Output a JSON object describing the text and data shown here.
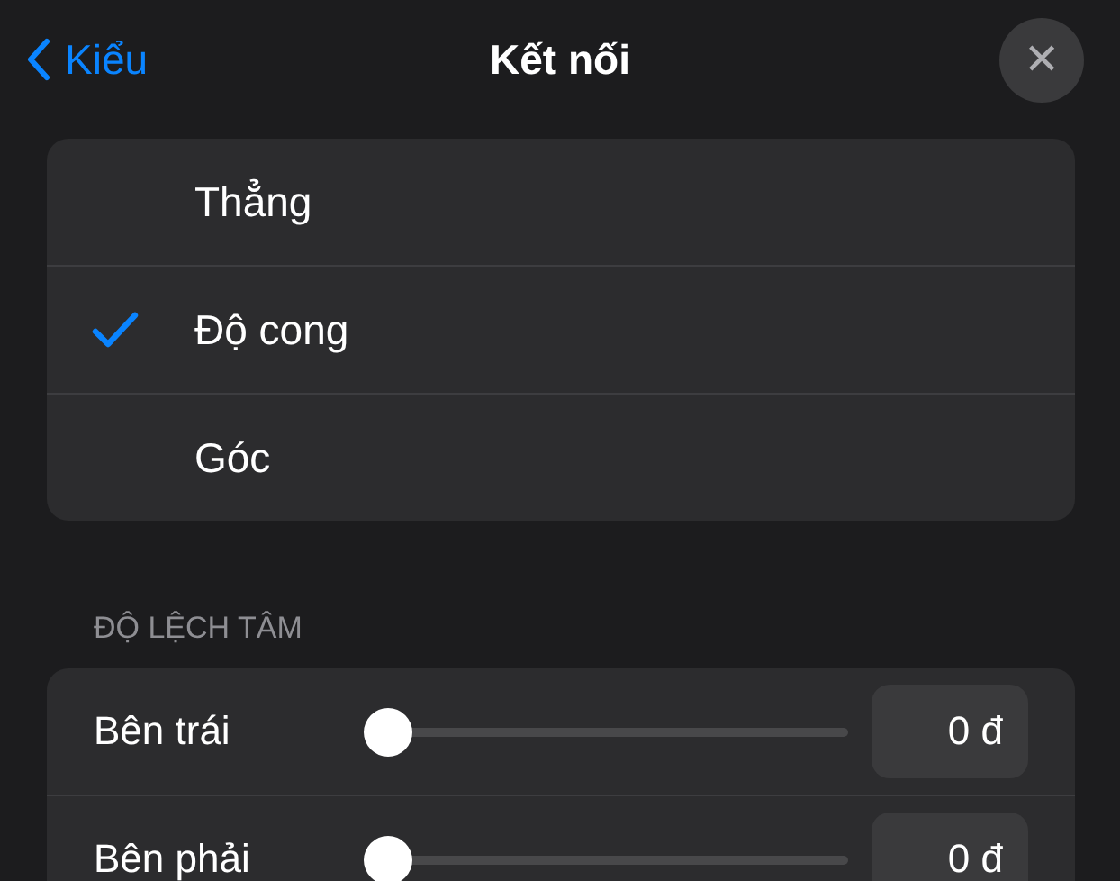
{
  "header": {
    "back": "Kiểu",
    "title": "Kết nối",
    "close": "✕"
  },
  "options": [
    {
      "label": "Thẳng",
      "selected": false
    },
    {
      "label": "Độ cong",
      "selected": true
    },
    {
      "label": "Góc",
      "selected": false
    }
  ],
  "section_title": "ĐỘ LỆCH TÂM",
  "offsets": [
    {
      "label": "Bên trái",
      "level": 0,
      "value": "0 đ"
    },
    {
      "label": "Bên phải",
      "level": 0,
      "value": "0 đ"
    }
  ]
}
